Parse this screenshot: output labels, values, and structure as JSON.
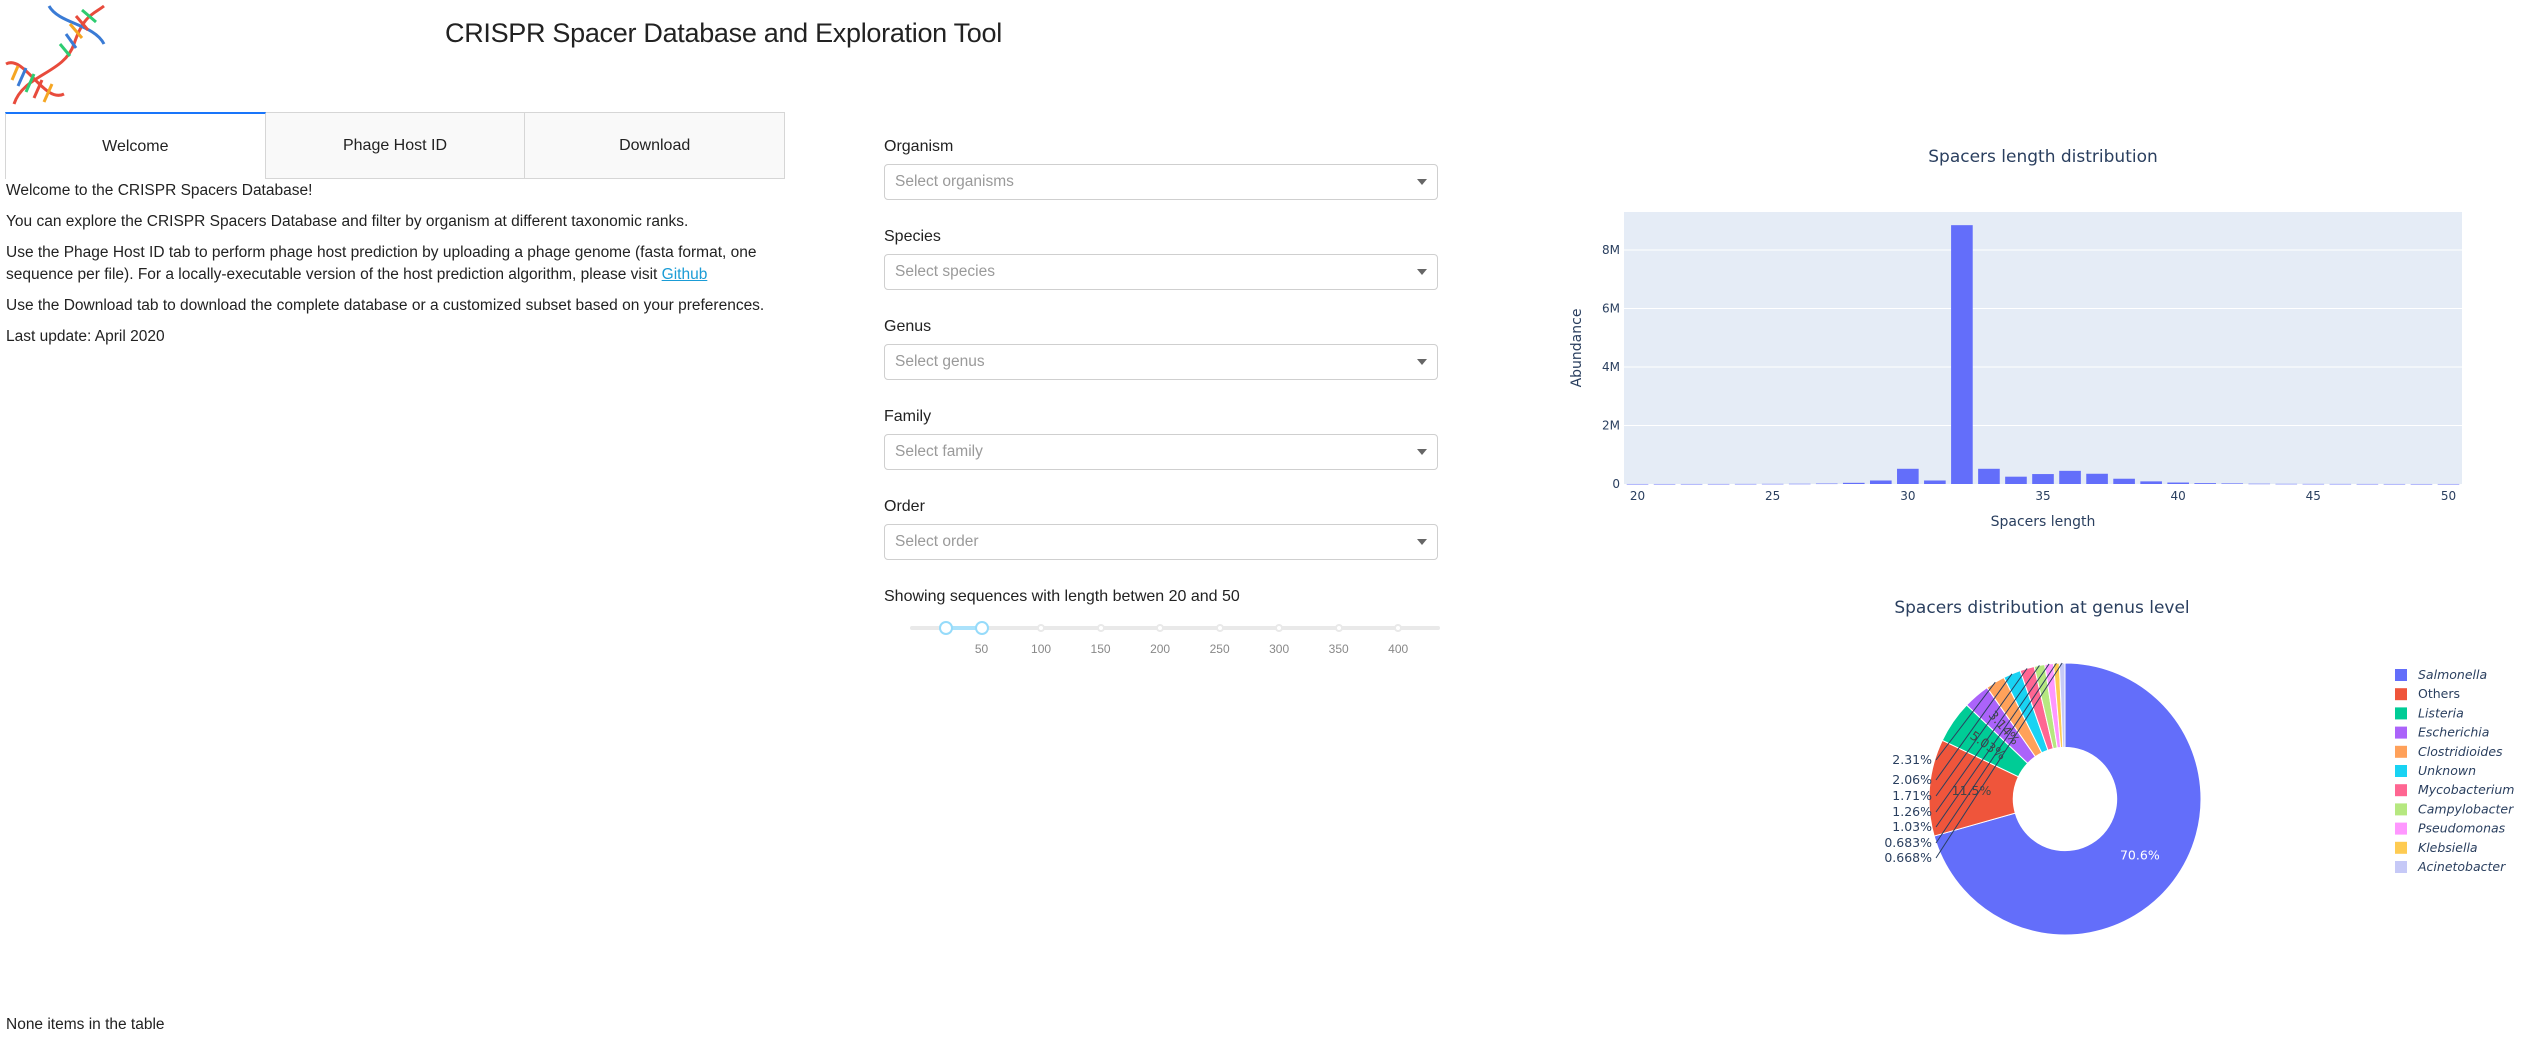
{
  "app": {
    "title": "CRISPR Spacer Database and Exploration Tool"
  },
  "tabs": [
    {
      "label": "Welcome",
      "active": true
    },
    {
      "label": "Phage Host ID",
      "active": false
    },
    {
      "label": "Download",
      "active": false
    }
  ],
  "welcome": {
    "line1": "Welcome to the CRISPR Spacers Database!",
    "line2": "You can explore the CRISPR Spacers Database and filter by organism at different taxonomic ranks.",
    "line3_prefix": "Use the Phage Host ID tab to perform phage host prediction by uploading a phage genome (fasta format, one sequence per file). For a locally-executable version of the host prediction algorithm, please visit ",
    "line3_link": "Github",
    "line4": "Use the Download tab to download the complete database or a customized subset based on your preferences.",
    "line5": "Last update: April 2020"
  },
  "table": {
    "count_text": "None items in the table"
  },
  "filters": [
    {
      "label": "Organism",
      "placeholder": "Select organisms"
    },
    {
      "label": "Species",
      "placeholder": "Select species"
    },
    {
      "label": "Genus",
      "placeholder": "Select genus"
    },
    {
      "label": "Family",
      "placeholder": "Select family"
    },
    {
      "label": "Order",
      "placeholder": "Select order"
    }
  ],
  "slider": {
    "label": "Showing sequences with length betwen 20 and 50",
    "min": 0,
    "max": 420,
    "value": [
      20,
      50
    ],
    "marks": [
      "50",
      "100",
      "150",
      "200",
      "250",
      "300",
      "350",
      "400"
    ]
  },
  "colors": {
    "accent": "#1975fa",
    "plot_bg": "#e5ecf6",
    "bar": "#636efa"
  },
  "chart_data": [
    {
      "type": "bar",
      "title": "Spacers length distribution",
      "xlabel": "Spacers length",
      "ylabel": "Abundance",
      "xlim": [
        19.5,
        50.5
      ],
      "ylim": [
        0,
        9300000
      ],
      "xticks": [
        20,
        25,
        30,
        35,
        40,
        45,
        50
      ],
      "yticks": [
        0,
        2000000,
        4000000,
        6000000,
        8000000
      ],
      "ytick_labels": [
        "0",
        "2M",
        "4M",
        "6M",
        "8M"
      ],
      "x": [
        20,
        21,
        22,
        23,
        24,
        25,
        26,
        27,
        28,
        29,
        30,
        31,
        32,
        33,
        34,
        35,
        36,
        37,
        38,
        39,
        40,
        41,
        42,
        43,
        44,
        45,
        46,
        47,
        48,
        49,
        50
      ],
      "values": [
        1000,
        1000,
        1500,
        2000,
        3000,
        5000,
        8000,
        15000,
        40000,
        120000,
        520000,
        120000,
        8850000,
        520000,
        250000,
        340000,
        450000,
        350000,
        180000,
        90000,
        50000,
        30000,
        20000,
        10000,
        6000,
        4000,
        3000,
        2000,
        1500,
        1000,
        1000
      ],
      "color": "#636efa",
      "grid": true
    },
    {
      "type": "pie",
      "title": "Spacers distribution at genus level",
      "hole": 0.38,
      "legend_position": "right",
      "labels": [
        "Salmonella",
        "Others",
        "Listeria",
        "Escherichia",
        "Clostridioides",
        "Unknown",
        "Mycobacterium",
        "Campylobacter",
        "Pseudomonas",
        "Klebsiella",
        "Acinetobacter"
      ],
      "legend_italic": [
        true,
        false,
        true,
        true,
        true,
        true,
        true,
        true,
        true,
        true,
        true
      ],
      "values": [
        70.6,
        11.5,
        5.03,
        3.14,
        2.31,
        2.06,
        1.71,
        1.26,
        1.03,
        0.683,
        0.668
      ],
      "value_labels": [
        "70.6%",
        "11.5%",
        "5.03%",
        "3.14%",
        "2.31%",
        "2.06%",
        "1.71%",
        "1.26%",
        "1.03%",
        "0.683%",
        "0.668%"
      ],
      "colors": [
        "#636efa",
        "#ef553b",
        "#00cc96",
        "#ab63fa",
        "#ffa15a",
        "#19d3f3",
        "#ff6692",
        "#b6e880",
        "#ff97ff",
        "#fecb52",
        "#c6c9f7"
      ]
    }
  ]
}
